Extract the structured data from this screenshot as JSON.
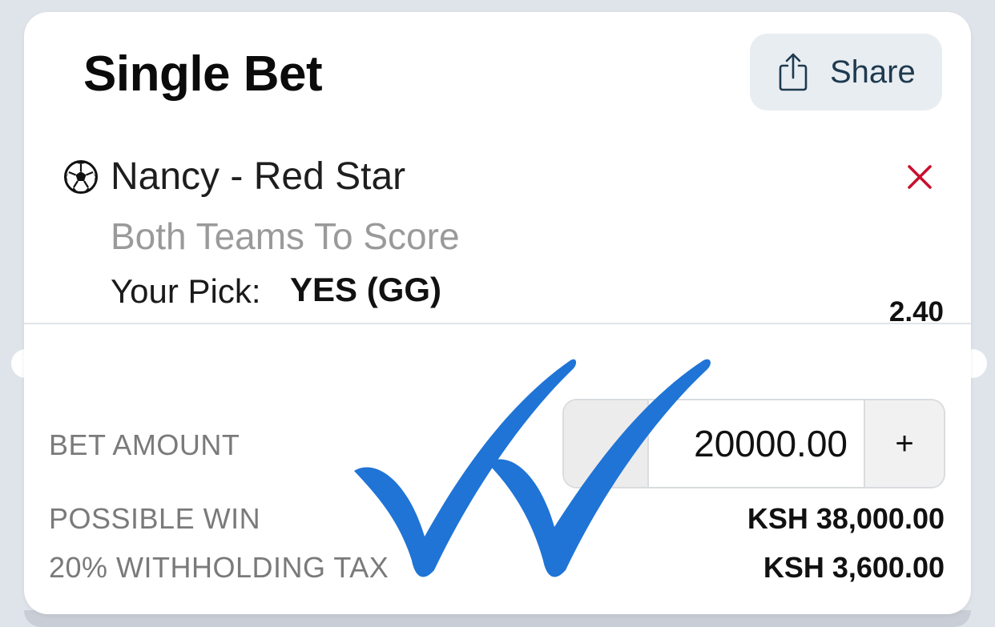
{
  "bet_slip": {
    "title": "Single Bet",
    "share_label": "Share",
    "event_name": "Nancy - Red Star",
    "market": "Both Teams To Score",
    "pick_label": "Your Pick:",
    "pick_value": "YES (GG)",
    "odds": "2.40"
  },
  "summary": {
    "bet_amount_label": "BET AMOUNT",
    "bet_amount_value": "20000.00",
    "increment_label": "+",
    "possible_win_label": "POSSIBLE WIN",
    "possible_win_value": "KSH 38,000.00",
    "tax_label": "20% WITHHOLDING TAX",
    "tax_value": "KSH 3,600.00"
  },
  "icons": {
    "share": "share-icon",
    "sport": "soccer-ball-icon",
    "remove": "close-icon",
    "overlay": "double-checkmark-icon"
  },
  "colors": {
    "remove": "#c8102e",
    "share_button_bg": "#e8edf1",
    "share_text": "#1e3a4f",
    "checkmark": "#1f74d6"
  }
}
